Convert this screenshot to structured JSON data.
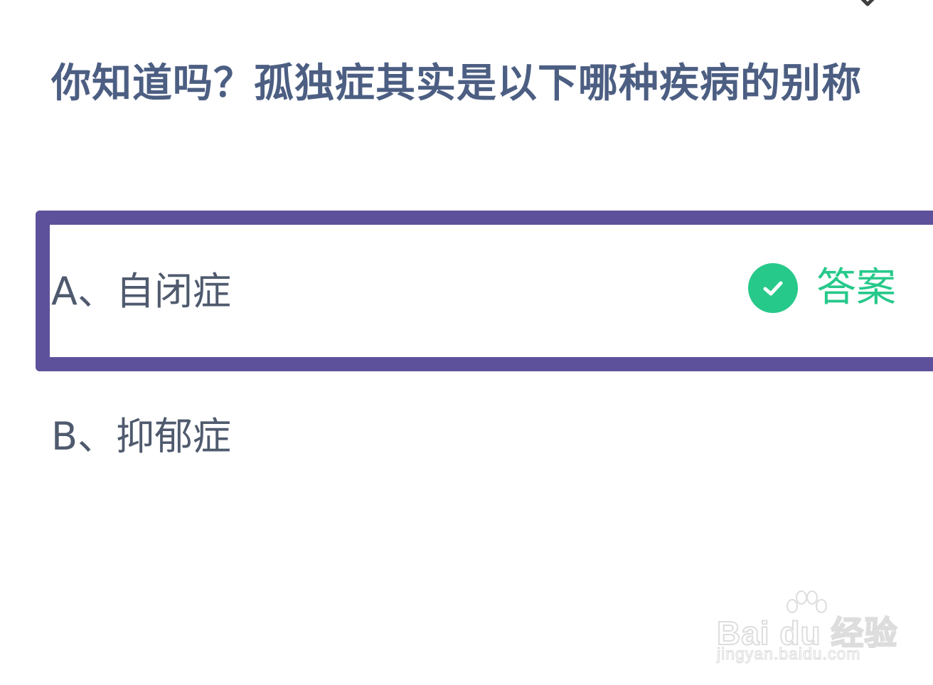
{
  "header": {
    "close_icon": "close-icon"
  },
  "question": {
    "text": "你知道吗？孤独症其实是以下哪种疾病的别称"
  },
  "options": [
    {
      "label": "A、自闭症",
      "selected": true,
      "is_answer": true,
      "answer_badge": "答案",
      "badge_icon": "check-circle-icon"
    },
    {
      "label": "B、抑郁症",
      "selected": false,
      "is_answer": false
    }
  ],
  "watermark": {
    "logo_text": "Bai du 经验",
    "url": "jingyan.baidu.com"
  },
  "colors": {
    "question_text": "#4c5e82",
    "option_text": "#4f5a6e",
    "selected_border": "#5e519c",
    "answer_green": "#27c98a"
  }
}
